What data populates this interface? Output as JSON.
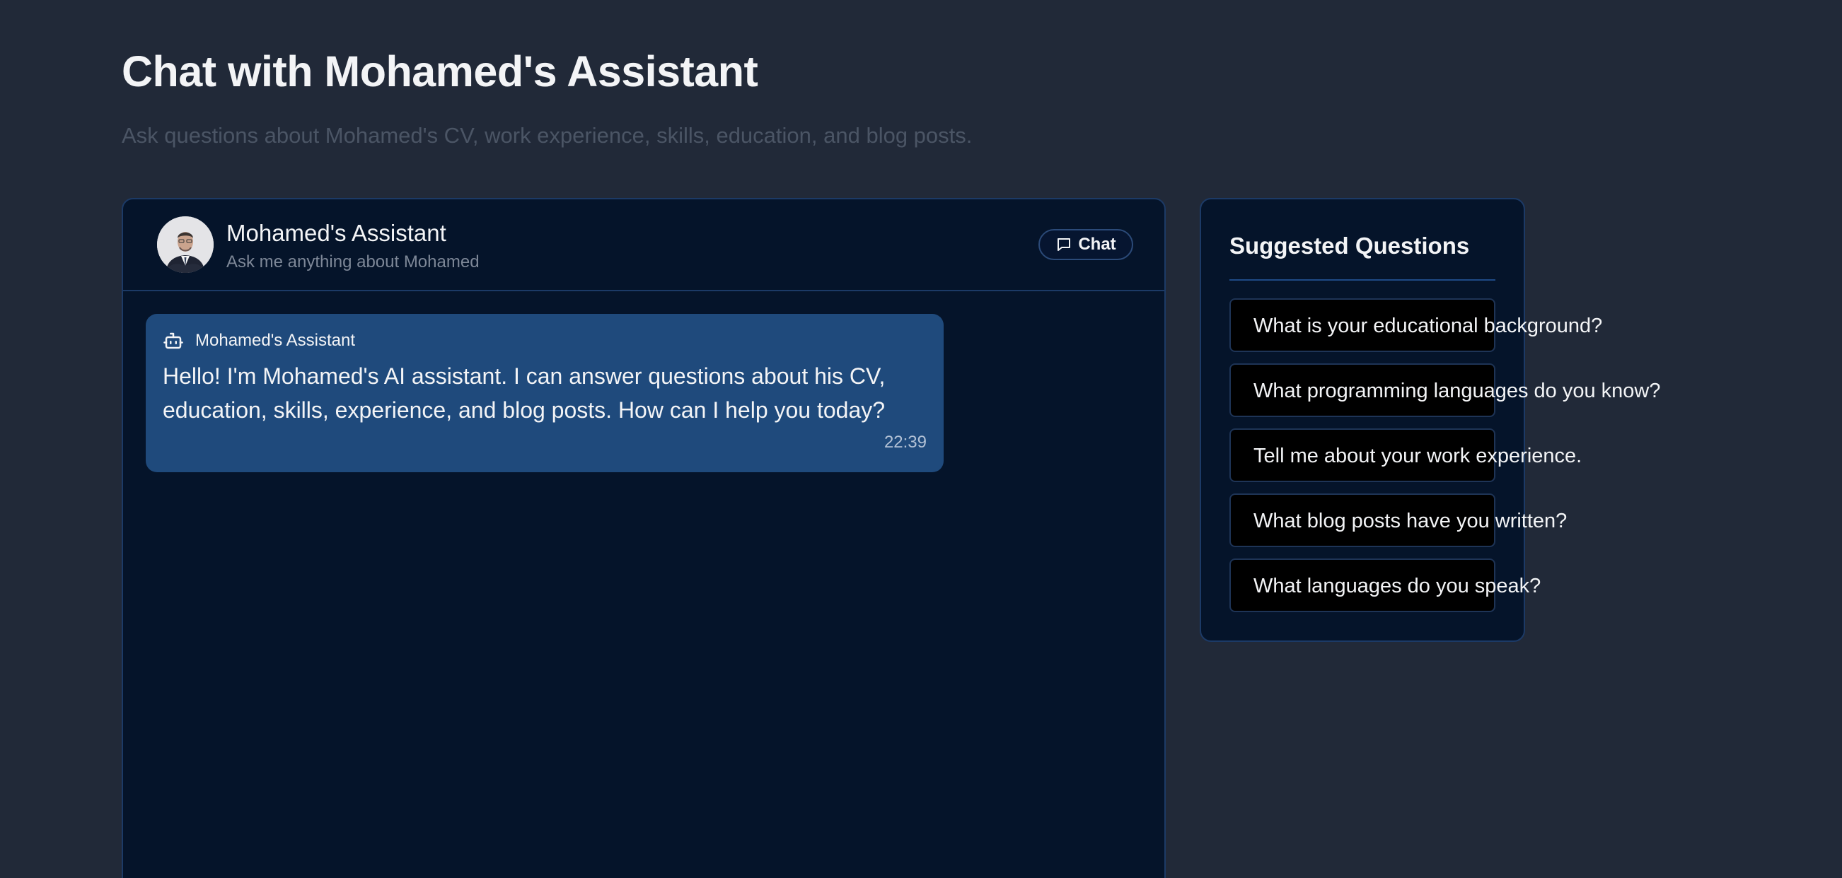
{
  "page": {
    "title": "Chat with Mohamed's Assistant",
    "subtitle": "Ask questions about Mohamed's CV, work experience, skills, education, and blog posts."
  },
  "chat": {
    "assistant_name": "Mohamed's Assistant",
    "tagline": "Ask me anything about Mohamed",
    "badge_label": "Chat",
    "badge_icon": "message-square-icon",
    "avatar": "assistant-avatar-photo",
    "messages": [
      {
        "sender": "Mohamed's Assistant",
        "sender_icon": "bot-icon",
        "text": "Hello! I'm Mohamed's AI assistant. I can answer questions about his CV, education, skills, experience, and blog posts. How can I help you today?",
        "time": "22:39"
      }
    ]
  },
  "suggestions": {
    "title": "Suggested Questions",
    "items": [
      "What is your educational background?",
      "What programming languages do you know?",
      "Tell me about your work experience.",
      "What blog posts have you written?",
      "What languages do you speak?"
    ]
  },
  "colors": {
    "background": "#212938",
    "panel": "#05142a",
    "panel_border": "#1c3a66",
    "message_bubble": "#1f4a7c",
    "question_button": "#000000"
  }
}
